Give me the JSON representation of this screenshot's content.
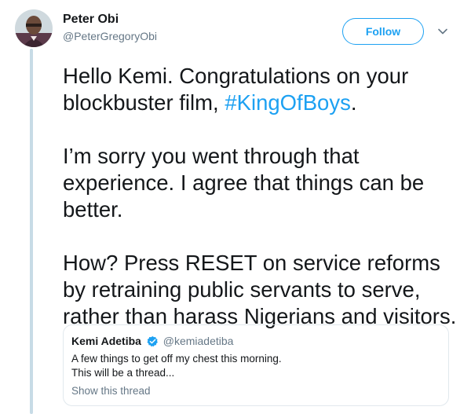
{
  "author": {
    "name": "Peter Obi",
    "handle": "@PeterGregoryObi",
    "avatar_icon": "profile-avatar"
  },
  "actions": {
    "follow_label": "Follow",
    "more_icon": "chevron-down-icon"
  },
  "tweet": {
    "paragraph1_prefix": "Hello Kemi. Congratulations on your blockbuster film, ",
    "paragraph1_hashtag": "#KingOfBoys",
    "paragraph1_suffix": ".",
    "paragraph2": "I’m sorry you went through that experience. I agree that things can be better.",
    "paragraph3": "How? Press RESET on service reforms by retraining public servants to serve, rather than harass Nigerians and visitors."
  },
  "quoted_tweet": {
    "name": "Kemi Adetiba",
    "verified_icon": "verified-badge-icon",
    "handle": "@kemiadetiba",
    "line1": "A few things to get off my chest this morning.",
    "line2": "This will be a thread...",
    "show_thread_label": "Show this thread"
  },
  "colors": {
    "link_blue": "#1da1f2",
    "secondary_text": "#657786",
    "thread_line": "#c7dbe6"
  }
}
